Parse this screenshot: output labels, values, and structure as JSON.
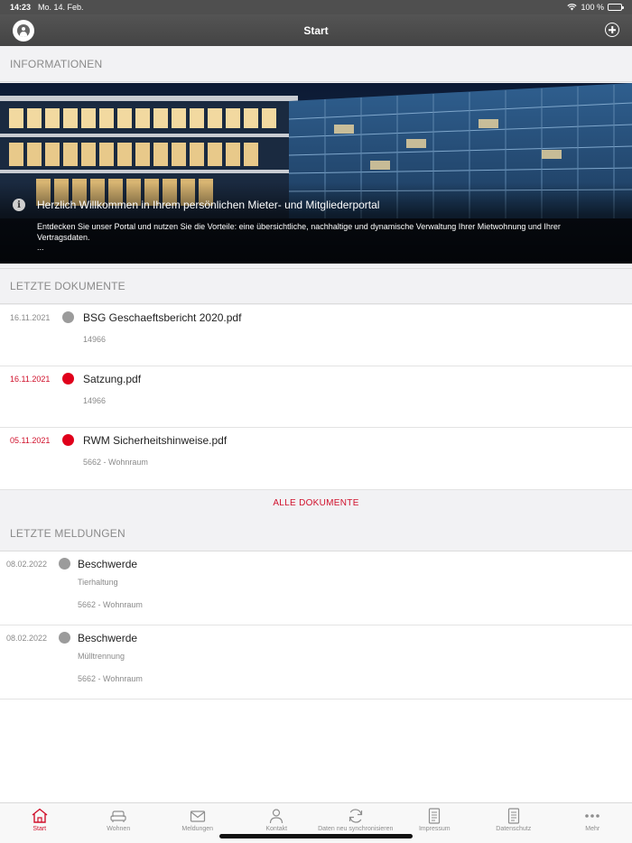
{
  "status_bar": {
    "time": "14:23",
    "date": "Mo. 14. Feb.",
    "battery": "100 %"
  },
  "nav": {
    "title": "Start"
  },
  "info": {
    "header": "INFORMATIONEN",
    "title": "Herzlich Willkommen in Ihrem persönlichen Mieter- und Mitgliederportal",
    "description": "Entdecken Sie unser Portal und nutzen Sie die Vorteile: eine übersichtliche, nachhaltige und dynamische Verwaltung Ihrer Mietwohnung und Ihrer Vertragsdaten.",
    "ellipsis": "..."
  },
  "documents": {
    "header": "LETZTE DOKUMENTE",
    "items": [
      {
        "date": "16.11.2021",
        "title": "BSG Geschaeftsbericht 2020.pdf",
        "sub": "14966",
        "status": "read"
      },
      {
        "date": "16.11.2021",
        "title": "Satzung.pdf",
        "sub": "14966",
        "status": "unread"
      },
      {
        "date": "05.11.2021",
        "title": "RWM Sicherheitshinweise.pdf",
        "sub": "5662 - Wohnraum",
        "status": "unread"
      }
    ],
    "all_label": "ALLE DOKUMENTE"
  },
  "messages": {
    "header": "LETZTE MELDUNGEN",
    "items": [
      {
        "date": "08.02.2022",
        "title": "Beschwerde",
        "category": "Tierhaltung",
        "sub": "5662 - Wohnraum"
      },
      {
        "date": "08.02.2022",
        "title": "Beschwerde",
        "category": "Mülltrennung",
        "sub": "5662 - Wohnraum"
      }
    ]
  },
  "tabs": [
    {
      "label": "Start",
      "icon": "home-icon",
      "active": true
    },
    {
      "label": "Wohnen",
      "icon": "sofa-icon"
    },
    {
      "label": "Meldungen",
      "icon": "envelope-icon"
    },
    {
      "label": "Kontakt",
      "icon": "person-icon"
    },
    {
      "label": "Daten neu synchronisieren",
      "icon": "sync-icon"
    },
    {
      "label": "Impressum",
      "icon": "document-icon"
    },
    {
      "label": "Datenschutz",
      "icon": "document-icon"
    },
    {
      "label": "Mehr",
      "icon": "more-icon"
    }
  ],
  "colors": {
    "accent": "#d0102b",
    "unread_dot": "#e0001b",
    "read_dot": "#9b9b9b",
    "navbar": "#4f4f4f"
  }
}
